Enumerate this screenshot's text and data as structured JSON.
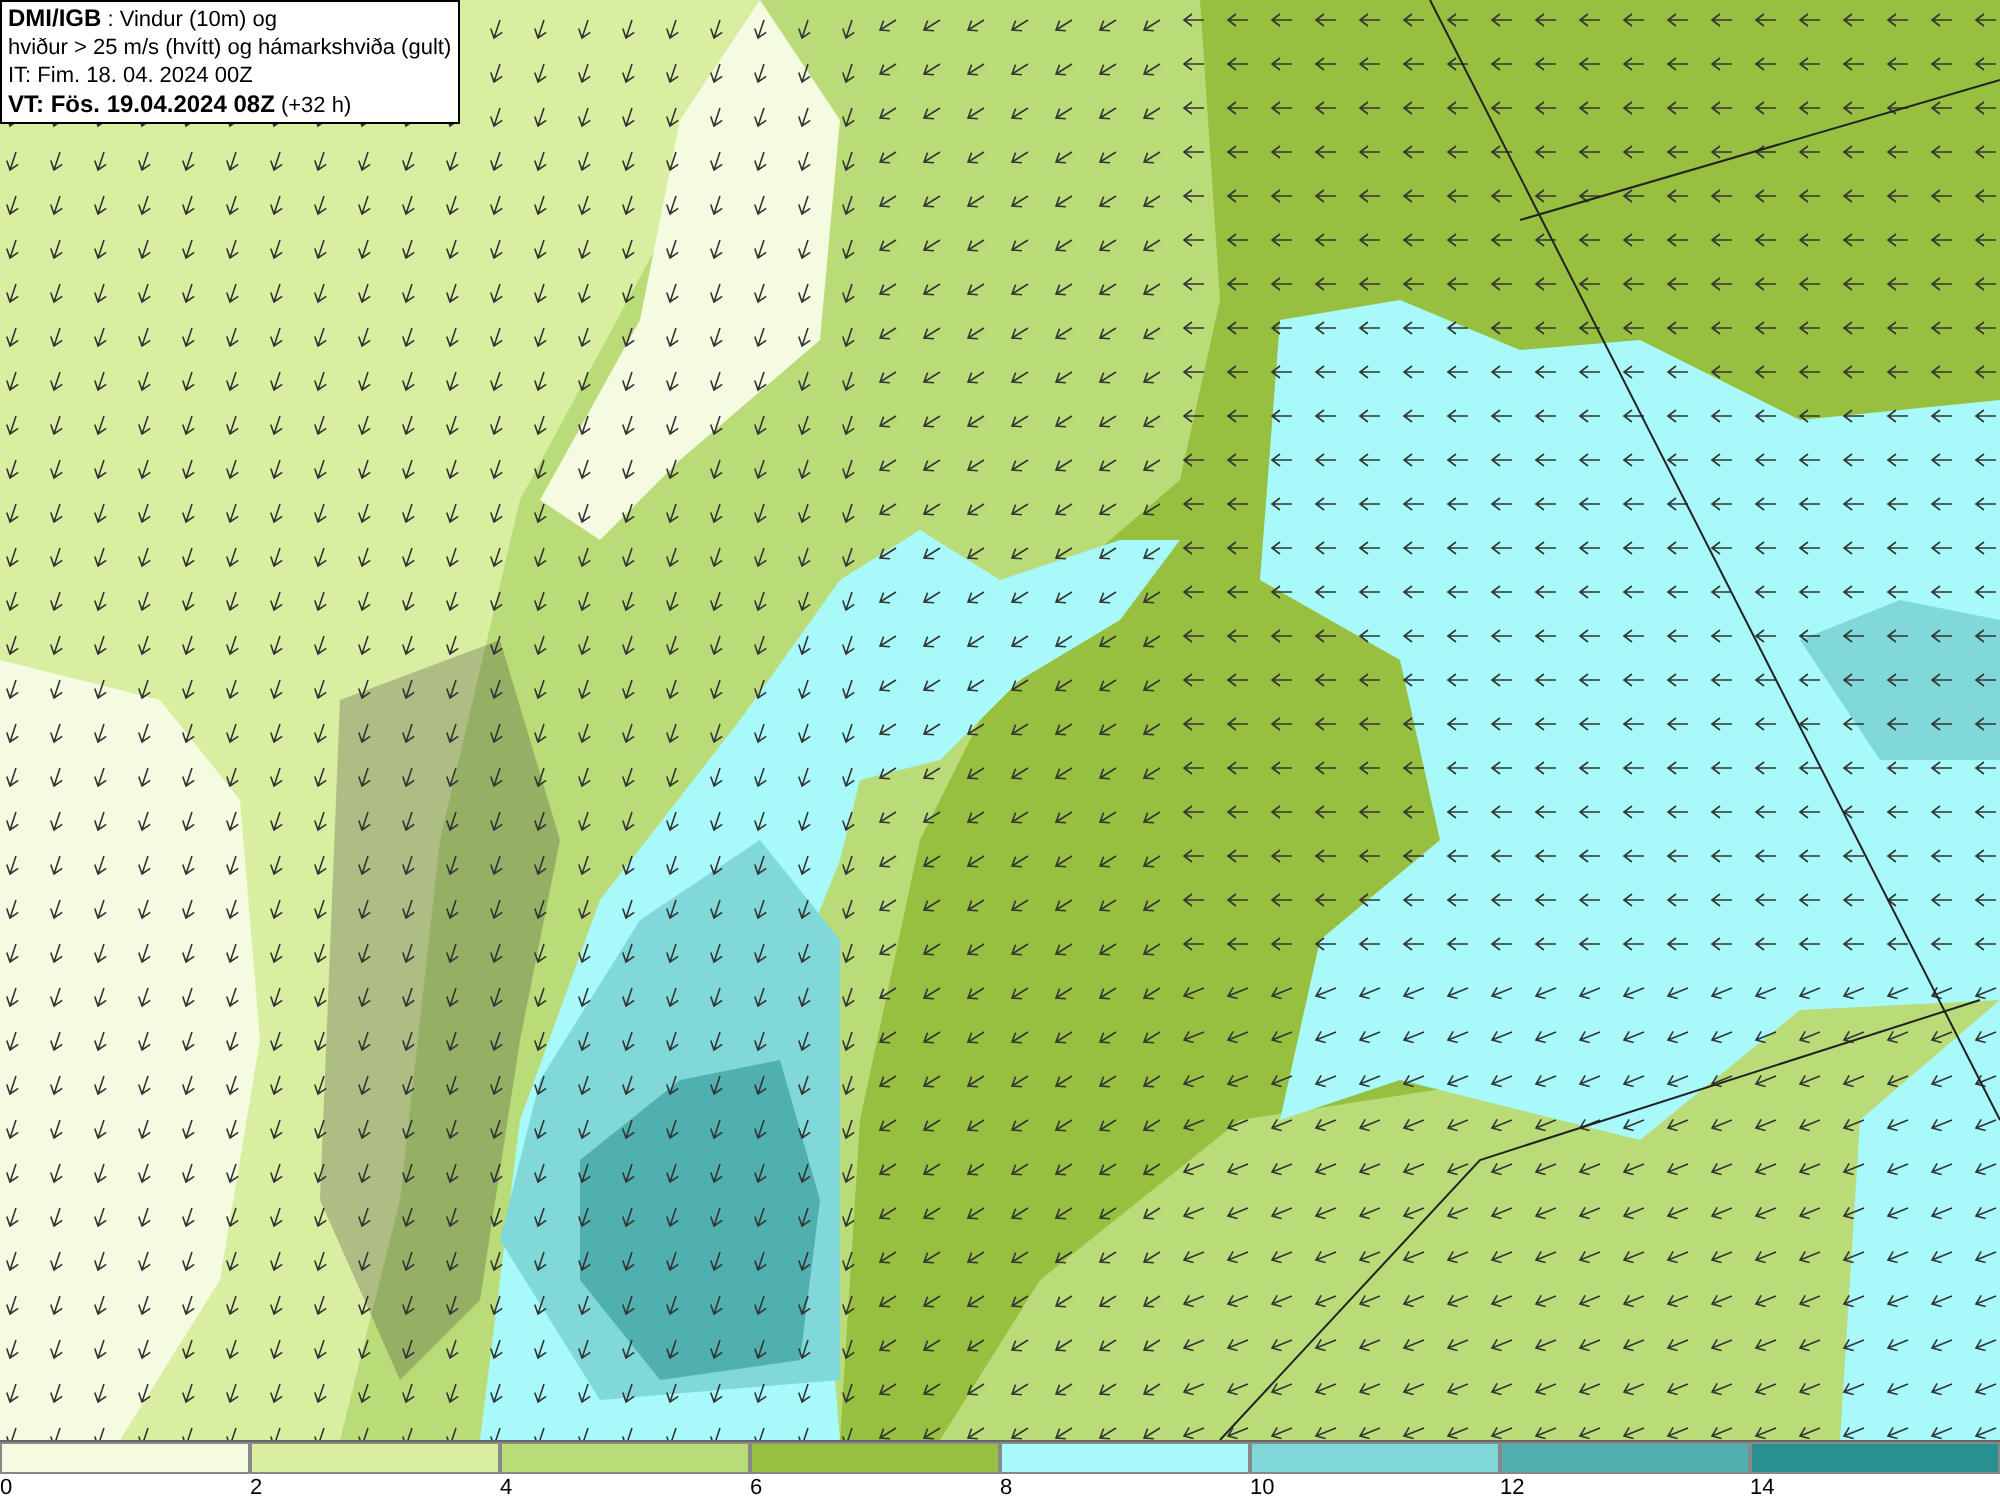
{
  "title_box": {
    "lines": [
      "**DMI/IGB** : Vindur (10m) og",
      "hviður > 25 m/s (hvítt) og hámarkshviða (gult)",
      "IT: Fim. 18. 04. 2024 00Z",
      "**VT: Fös. 19.04.2024 08Z** (+32 h)"
    ]
  },
  "legend": [
    {
      "color": "#f4fbe0",
      "label": "0"
    },
    {
      "color": "#d8eea0",
      "label": "2"
    },
    {
      "color": "#b9dc78",
      "label": "4"
    },
    {
      "color": "#98c040",
      "label": "6"
    },
    {
      "color": "#a8fafa",
      "label": "8"
    },
    {
      "color": "#80d8d8",
      "label": "10"
    },
    {
      "color": "#50b0b0",
      "label": "12"
    },
    {
      "color": "#289090",
      "label": "14"
    }
  ]
}
